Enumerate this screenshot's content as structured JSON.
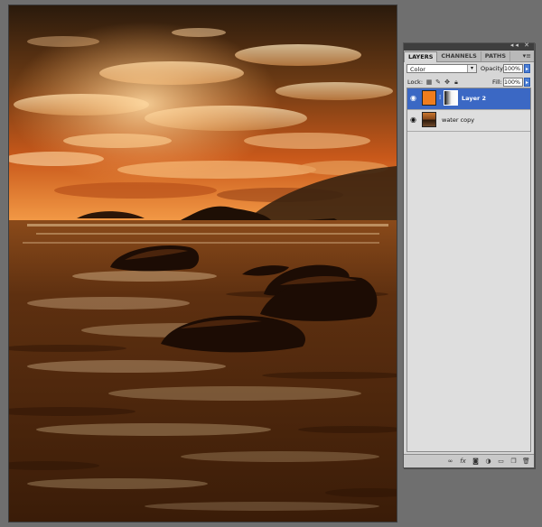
{
  "panel": {
    "tabs": [
      {
        "label": "LAYERS",
        "active": true
      },
      {
        "label": "CHANNELS",
        "active": false
      },
      {
        "label": "PATHS",
        "active": false
      }
    ],
    "blend_mode": "Color",
    "opacity_label": "Opacity:",
    "opacity_value": "100%",
    "lock_label": "Lock:",
    "fill_label": "Fill:",
    "fill_value": "100%",
    "layers": [
      {
        "name": "Layer 2",
        "selected": true,
        "visible": true,
        "thumb_color": "#f07d1e",
        "has_mask": true
      },
      {
        "name": "water copy",
        "selected": false,
        "visible": true,
        "has_mask": false
      }
    ],
    "bottom_icons": [
      "link-layers-icon",
      "fx-icon",
      "add-mask-icon",
      "adjustment-layer-icon",
      "group-icon",
      "new-layer-icon",
      "trash-icon"
    ]
  },
  "colors": {
    "accent": "#3b68c4",
    "orange_fill": "#f07d1e"
  }
}
